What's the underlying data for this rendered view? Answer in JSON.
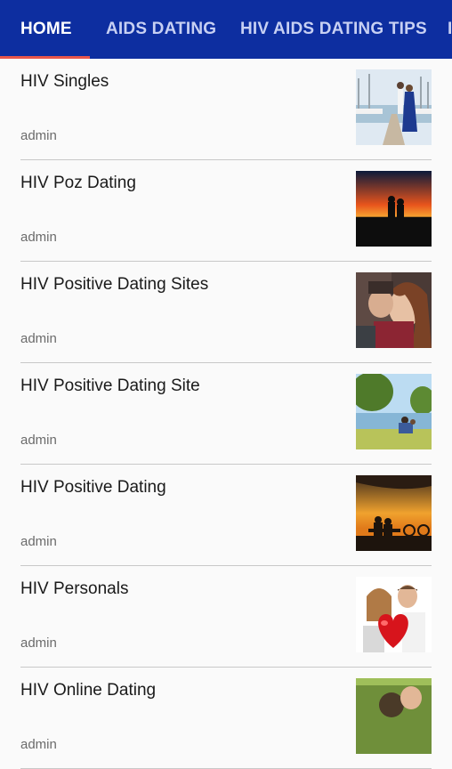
{
  "tabs": [
    {
      "label": "HOME",
      "active": true
    },
    {
      "label": "AIDS DATING",
      "active": false
    },
    {
      "label": "HIV AIDS DATING TIPS",
      "active": false
    },
    {
      "label": "I",
      "active": false
    }
  ],
  "colors": {
    "tabbar_bg": "#0d2ea0",
    "tab_indicator": "#e8574c",
    "page_bg": "#fafafa"
  },
  "posts": [
    {
      "title": "HIV Singles",
      "author": "admin",
      "thumbnail": "couple-on-pier-photo"
    },
    {
      "title": "HIV Poz Dating",
      "author": "admin",
      "thumbnail": "couple-silhouette-sunset-photo"
    },
    {
      "title": "HIV Positive Dating Sites",
      "author": "admin",
      "thumbnail": "couple-kissing-winter-photo"
    },
    {
      "title": "HIV Positive Dating Site",
      "author": "admin",
      "thumbnail": "couple-lakeside-park-photo"
    },
    {
      "title": "HIV Positive Dating",
      "author": "admin",
      "thumbnail": "couple-bench-sunset-photo"
    },
    {
      "title": "HIV Personals",
      "author": "admin",
      "thumbnail": "couple-red-heart-balloon-photo"
    },
    {
      "title": "HIV Online Dating",
      "author": "admin",
      "thumbnail": "couple-outdoors-photo"
    }
  ]
}
